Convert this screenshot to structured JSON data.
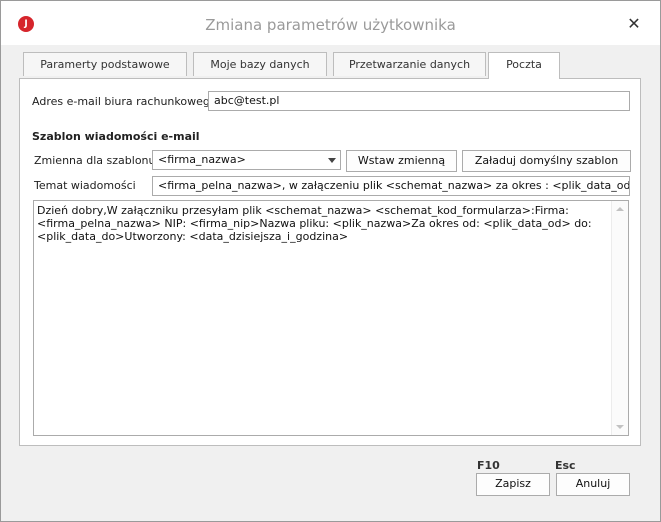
{
  "window": {
    "title": "Zmiana parametrów użytkownika",
    "app_icon_letter": "J",
    "close_glyph": "✕"
  },
  "tabs": [
    {
      "label": "Paramerty podstawowe",
      "active": false
    },
    {
      "label": "Moje bazy danych",
      "active": false
    },
    {
      "label": "Przetwarzanie danych",
      "active": false
    },
    {
      "label": "Poczta",
      "active": true
    }
  ],
  "form": {
    "email_label": "Adres e-mail biura rachunkowego",
    "email_value": "abc@test.pl",
    "section_title": "Szablon wiadomości e-mail",
    "variable_label": "Zmienna dla szablonu",
    "variable_value": "<firma_nazwa>",
    "insert_button": "Wstaw zmienną",
    "load_default_button": "Załaduj domyślny szablon",
    "subject_label": "Temat wiadomości",
    "subject_value": "<firma_pelna_nazwa>, w załączeniu plik <schemat_nazwa> za okres : <plik_data_od> do <",
    "body_text": "Dzień dobry,W załączniku przesyłam plik <schemat_nazwa> <schemat_kod_formularza>:Firma:\n<firma_pelna_nazwa> NIP: <firma_nip>Nazwa pliku: <plik_nazwa>Za okres od: <plik_data_od> do:\n<plik_data_do>Utworzony: <data_dzisiejsza_i_godzina>"
  },
  "footer": {
    "save_shortcut": "F10",
    "save_label": "Zapisz",
    "cancel_shortcut": "Esc",
    "cancel_label": "Anuluj"
  },
  "colors": {
    "app_icon": "#d6252c",
    "title_text": "#9a9a9a",
    "window_bg": "#f0f0f0"
  }
}
